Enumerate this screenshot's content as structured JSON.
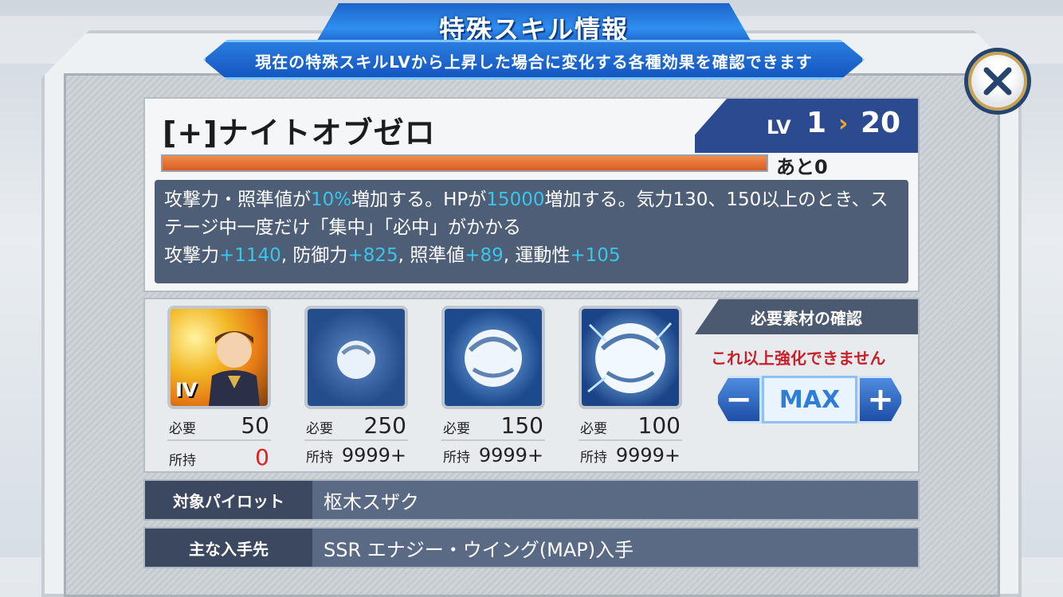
{
  "header": {
    "title": "特殊スキル情報",
    "subtitle": "現在の特殊スキルLVから上昇した場合に変化する各種効果を確認できます"
  },
  "skill": {
    "name": "[+]ナイトオブゼロ",
    "lv_label": "LV",
    "lv_current": "1",
    "lv_arrow": "›",
    "lv_max": "20",
    "progress_fraction": 1.0,
    "remaining": "あと0",
    "desc_parts": {
      "p1": "攻撃力・照準値が",
      "p2": "10%",
      "p3": "増加する。HPが",
      "p4": "15000",
      "p5": "増加する。気力130、150以上のとき、ステージ中一度だけ「集中」「必中」がかかる",
      "s1": "攻撃力",
      "s1v": "+1140",
      "s2": ", 防御力",
      "s2v": "+825",
      "s3": ", 照準値",
      "s3v": "+89",
      "s4": ", 運動性",
      "s4v": "+105"
    }
  },
  "materials": {
    "items": [
      {
        "icon": "pilot-character-icon",
        "badge": "IV",
        "need_label": "必要",
        "need": "50",
        "have_label": "所持",
        "have": "0"
      },
      {
        "icon": "orb-small-icon",
        "need_label": "必要",
        "need": "250",
        "have_label": "所持",
        "have": "9999+"
      },
      {
        "icon": "orb-medium-icon",
        "need_label": "必要",
        "need": "150",
        "have_label": "所持",
        "have": "9999+"
      },
      {
        "icon": "orb-large-icon",
        "need_label": "必要",
        "need": "100",
        "have_label": "所持",
        "have": "9999+"
      }
    ],
    "confirm_label": "必要素材の確認",
    "cannot_text": "これ以上強化できません",
    "stepper": {
      "minus": "−",
      "value": "MAX",
      "plus": "+"
    }
  },
  "info": {
    "pilot_key": "対象パイロット",
    "pilot_val": "枢木スザク",
    "source_key": "主な入手先",
    "source_val": "SSR エナジー・ウイング(MAP)入手"
  },
  "colors": {
    "accent_blue": "#2f8ff0",
    "highlight_cyan": "#39c6ea",
    "progress_orange": "#d85e24",
    "warning_red": "#c8202a"
  }
}
